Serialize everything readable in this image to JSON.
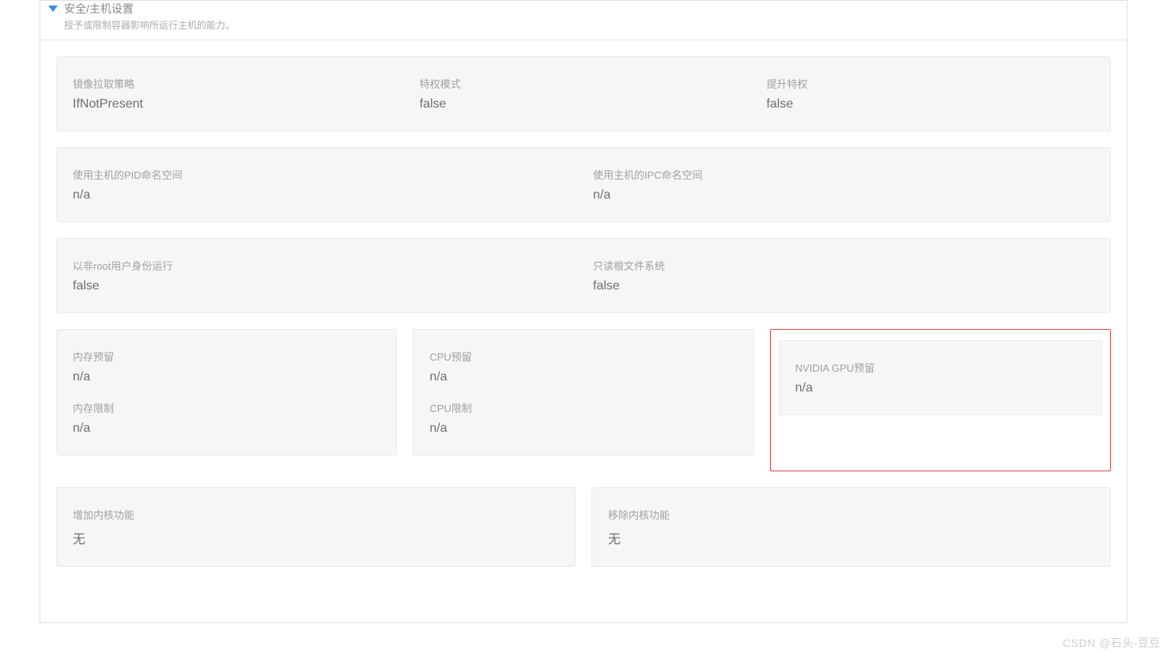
{
  "section": {
    "title": "安全/主机设置",
    "subtitle": "授予或限制容器影响所运行主机的能力。"
  },
  "card1": {
    "imagePullPolicy": {
      "label": "镜像拉取策略",
      "value": "IfNotPresent"
    },
    "privileged": {
      "label": "特权模式",
      "value": "false"
    },
    "allowPrivilegeEscalation": {
      "label": "提升特权",
      "value": "false"
    }
  },
  "card2": {
    "hostPid": {
      "label": "使用主机的PID命名空间",
      "value": "n/a"
    },
    "hostIpc": {
      "label": "使用主机的IPC命名空间",
      "value": "n/a"
    }
  },
  "card3": {
    "runAsNonRoot": {
      "label": "以非root用户身份运行",
      "value": "false"
    },
    "readOnlyRoot": {
      "label": "只读根文件系统",
      "value": "false"
    }
  },
  "resources": {
    "memReserve": {
      "label": "内存预留",
      "value": "n/a"
    },
    "memLimit": {
      "label": "内存限制",
      "value": "n/a"
    },
    "cpuReserve": {
      "label": "CPU预留",
      "value": "n/a"
    },
    "cpuLimit": {
      "label": "CPU限制",
      "value": "n/a"
    },
    "gpuReserve": {
      "label": "NVIDIA GPU预留",
      "value": "n/a"
    }
  },
  "capabilities": {
    "add": {
      "label": "增加内核功能",
      "value": "无"
    },
    "drop": {
      "label": "移除内核功能",
      "value": "无"
    }
  },
  "watermark": "CSDN @石头-豆豆"
}
